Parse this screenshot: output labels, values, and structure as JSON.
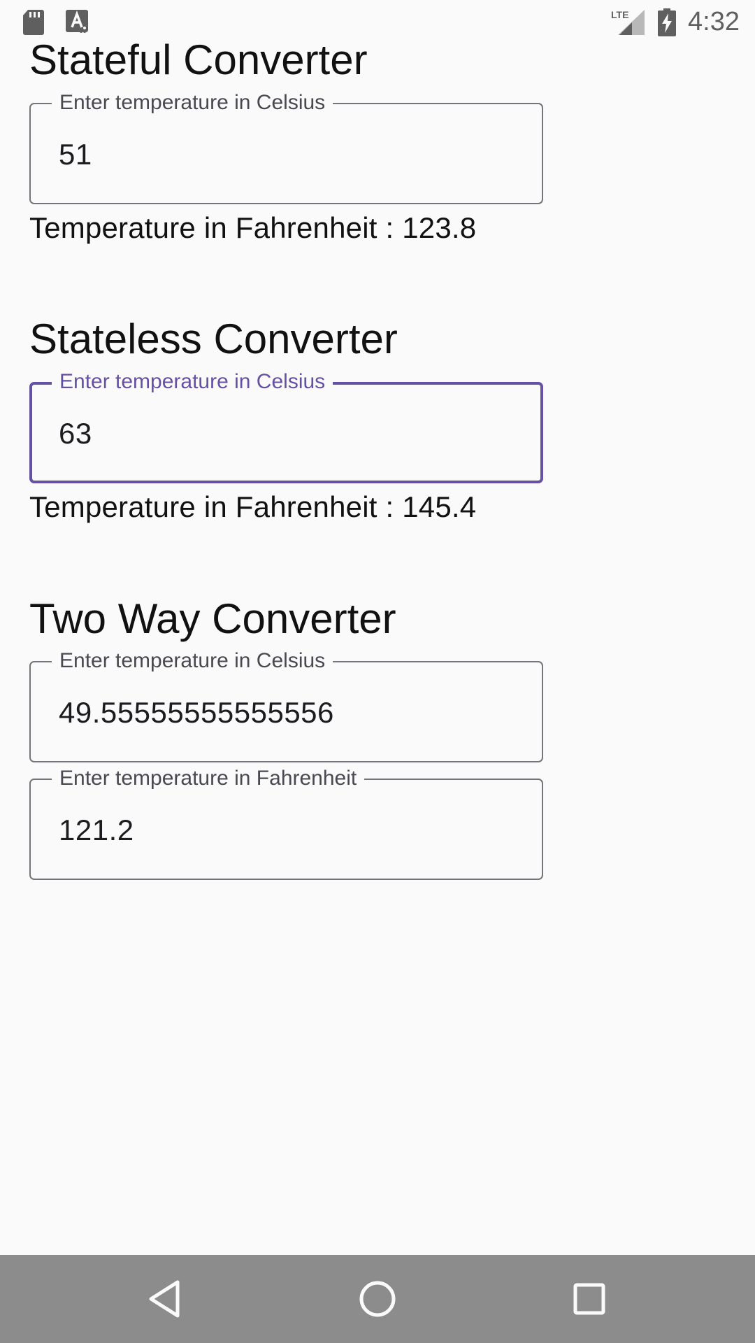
{
  "status_bar": {
    "time": "4:32",
    "left_icons": [
      "sd-card-icon",
      "font-accessibility-icon"
    ],
    "right_icons": [
      "lte-signal-icon",
      "battery-charging-icon"
    ]
  },
  "stateful": {
    "title": "Stateful Converter",
    "input_label": "Enter temperature in Celsius",
    "input_value": "51",
    "result": "Temperature in Fahrenheit : 123.8"
  },
  "stateless": {
    "title": "Stateless Converter",
    "input_label": "Enter temperature in Celsius",
    "input_value": "63",
    "result": "Temperature in Fahrenheit : 145.4"
  },
  "two_way": {
    "title": "Two Way Converter",
    "celsius_label": "Enter temperature in Celsius",
    "celsius_value": "49.55555555555556",
    "fahrenheit_label": "Enter temperature in Fahrenheit",
    "fahrenheit_value": "121.2"
  },
  "nav_bar": {
    "buttons": [
      "back-icon",
      "home-icon",
      "recents-icon"
    ]
  },
  "colors": {
    "background": "#fafafa",
    "focus_accent": "#6650a4",
    "outline": "#76747a",
    "nav_bar": "#8c8c8c"
  }
}
